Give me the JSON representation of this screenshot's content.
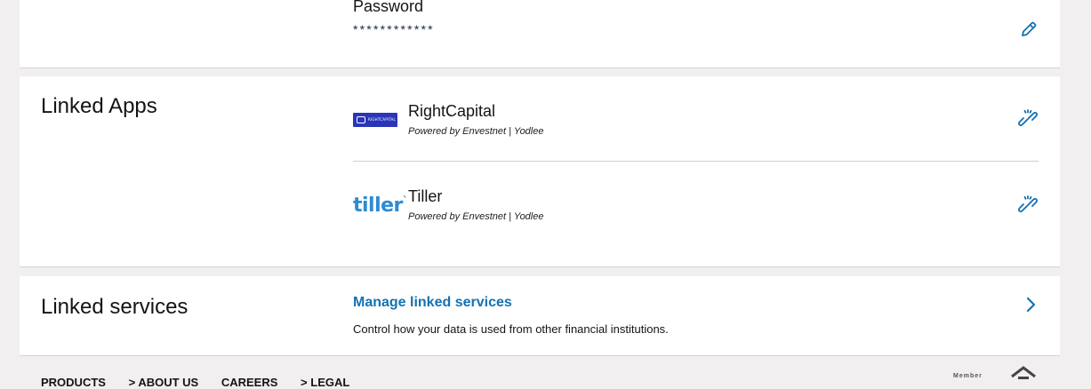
{
  "password": {
    "label": "Password",
    "masked_value": "************"
  },
  "linked_apps": {
    "title": "Linked Apps",
    "apps": [
      {
        "name": "RightCapital",
        "powered_by": "Powered by Envestnet | Yodlee",
        "logo_text": "RIGHTCAPITAL",
        "logo_color": "#2b35b8"
      },
      {
        "name": "Tiller",
        "powered_by": "Powered by Envestnet | Yodlee",
        "logo_text": "tiller",
        "logo_color": "#2e8bd1"
      }
    ]
  },
  "linked_services": {
    "title": "Linked services",
    "link_label": "Manage linked services",
    "description": "Control how your data is used from other financial institutions."
  },
  "footer": {
    "links": [
      "PRODUCTS",
      "ABOUT US",
      "CAREERS",
      "LEGAL"
    ],
    "fdic_text": "Member"
  },
  "colors": {
    "accent": "#1372b3",
    "background": "#f1eff0"
  }
}
